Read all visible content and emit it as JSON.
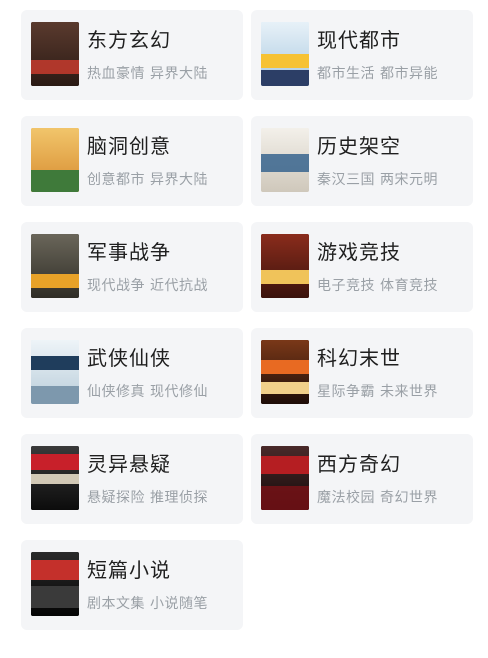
{
  "categories": [
    {
      "title": "东方玄幻",
      "subtitle": "热血豪情 异界大陆",
      "cover_color": "#3b2a24",
      "cover_accent": "#c63b2e",
      "cover_icon": "fantasy-book-cover-icon"
    },
    {
      "title": "现代都市",
      "subtitle": "都市生活 都市异能",
      "cover_color": "#cfe4f2",
      "cover_accent": "#f6c233",
      "cover_icon": "urban-book-cover-icon"
    },
    {
      "title": "脑洞创意",
      "subtitle": "创意都市 异界大陆",
      "cover_color": "#e9a94b",
      "cover_accent": "#3f7a3a",
      "cover_icon": "creative-book-cover-icon"
    },
    {
      "title": "历史架空",
      "subtitle": "秦汉三国 两宋元明",
      "cover_color": "#e8e4dc",
      "cover_accent": "#2d5c8a",
      "cover_icon": "history-book-cover-icon"
    },
    {
      "title": "军事战争",
      "subtitle": "现代战争 近代抗战",
      "cover_color": "#4d4a3f",
      "cover_accent": "#e8a228",
      "cover_icon": "military-book-cover-icon"
    },
    {
      "title": "游戏竞技",
      "subtitle": "电子竞技 体育竞技",
      "cover_color": "#5a1e14",
      "cover_accent": "#f0c35a",
      "cover_icon": "gaming-book-cover-icon"
    },
    {
      "title": "武侠仙侠",
      "subtitle": "仙侠修真 现代修仙",
      "cover_color": "#dde8ef",
      "cover_accent": "#1f3d5c",
      "cover_icon": "wuxia-book-cover-icon"
    },
    {
      "title": "科幻末世",
      "subtitle": "星际争霸 未来世界",
      "cover_color": "#3a1b10",
      "cover_accent": "#e86a22",
      "cover_icon": "scifi-book-cover-icon"
    },
    {
      "title": "灵异悬疑",
      "subtitle": "悬疑探险 推理侦探",
      "cover_color": "#1e1e1e",
      "cover_accent": "#c8202a",
      "cover_icon": "mystery-book-cover-icon"
    },
    {
      "title": "西方奇幻",
      "subtitle": "魔法校园 奇幻世界",
      "cover_color": "#2a1a1a",
      "cover_accent": "#b51e22",
      "cover_icon": "western-fantasy-book-cover-icon"
    },
    {
      "title": "短篇小说",
      "subtitle": "剧本文集 小说随笔",
      "cover_color": "#141414",
      "cover_accent": "#c4302b",
      "cover_icon": "short-story-book-cover-icon"
    }
  ]
}
